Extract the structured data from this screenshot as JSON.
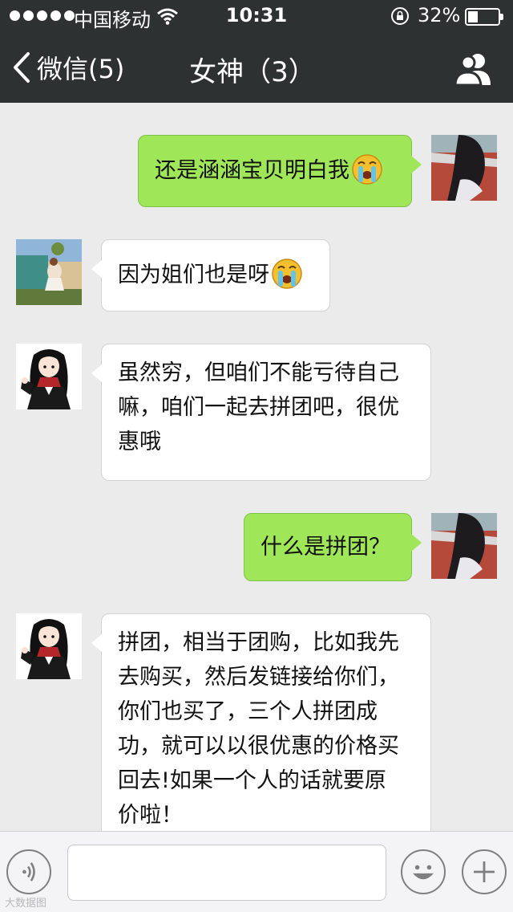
{
  "status_bar": {
    "carrier": "中国移动",
    "time": "10:31",
    "battery_percent": "32%",
    "battery_level": 0.32,
    "icons": [
      "signal-dots",
      "wifi-icon",
      "rotation-lock-icon",
      "battery-icon"
    ]
  },
  "nav": {
    "back_label": "微信(5)",
    "title": "女神（3）",
    "icons": [
      "chevron-left-icon",
      "group-contacts-icon"
    ]
  },
  "messages": [
    {
      "side": "right",
      "sender": "me",
      "avatar": "girl-on-track-photo",
      "text": "还是涵涵宝贝明白我",
      "emoji": "crying-face"
    },
    {
      "side": "left",
      "sender": "friend-1",
      "avatar": "girl-in-garden-photo",
      "text": "因为姐们也是呀",
      "emoji": "crying-face"
    },
    {
      "side": "left",
      "sender": "friend-2",
      "avatar": "anime-girl-avatar",
      "lines": [
        "虽然穷，但咱们不能亏待自己",
        "嘛，咱们一起去拼团吧，很优",
        "惠哦"
      ]
    },
    {
      "side": "right",
      "sender": "me",
      "avatar": "girl-on-track-photo",
      "text": "什么是拼团？"
    },
    {
      "side": "left",
      "sender": "friend-2",
      "avatar": "anime-girl-avatar",
      "lines": [
        "拼团，相当于团购，比如我先",
        "去购买，然后发链接给你们，",
        "你们也买了，三个人拼团成",
        "功，就可以以很优惠的价格买",
        "回去!如果一个人的话就要原",
        "价啦！"
      ]
    }
  ],
  "input_bar": {
    "text_value": "",
    "icons": [
      "voice-icon",
      "emoji-icon",
      "plus-icon"
    ]
  },
  "watermark": "大数据图",
  "colors": {
    "bar_bg": "#2e3132",
    "chat_bg": "#ebebeb",
    "my_bubble": "#9fe658",
    "their_bubble": "#ffffff"
  }
}
